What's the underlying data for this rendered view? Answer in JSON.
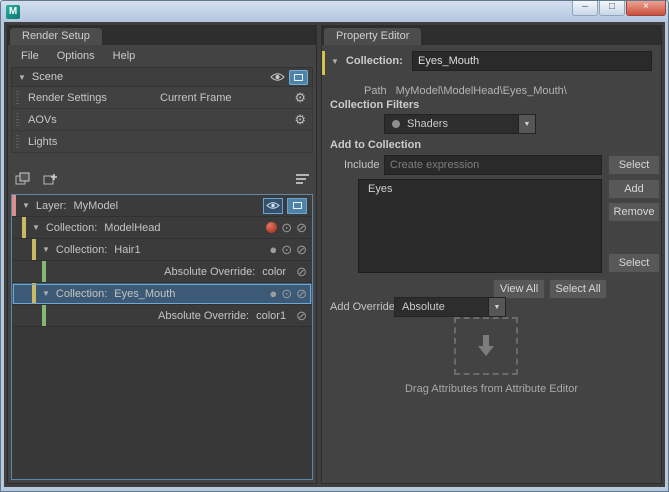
{
  "window": {
    "maya_icon": "M"
  },
  "icons": {
    "chevron_down": "▼",
    "gear": "⚙",
    "slash": "⊘",
    "target": "⊙",
    "dot": "●",
    "dropdown_arrow": "▼",
    "minimize": "–",
    "maximize": "□",
    "close": "×"
  },
  "left_panel": {
    "tab": "Render Setup",
    "menus": [
      "File",
      "Options",
      "Help"
    ],
    "scene": {
      "title": "Scene",
      "rows": [
        {
          "label": "Render Settings",
          "value": "Current Frame"
        },
        {
          "label": "AOVs"
        },
        {
          "label": "Lights"
        }
      ]
    },
    "tree": [
      {
        "label": "Layer:",
        "name": "MyModel"
      },
      {
        "label": "Collection:",
        "name": "ModelHead"
      },
      {
        "label": "Collection:",
        "name": "Hair1"
      },
      {
        "label": "Absolute Override:",
        "name": "color"
      },
      {
        "label": "Collection:",
        "name": "Eyes_Mouth"
      },
      {
        "label": "Absolute Override:",
        "name": "color1"
      }
    ]
  },
  "right_panel": {
    "tab": "Property Editor",
    "collection": {
      "label": "Collection:",
      "value": "Eyes_Mouth"
    },
    "path": {
      "label": "Path",
      "value": "MyModel\\ModelHead\\Eyes_Mouth\\"
    },
    "filters": {
      "label": "Collection Filters",
      "selected": "Shaders"
    },
    "add_to_collection": {
      "label": "Add to Collection",
      "include_label": "Include",
      "include_placeholder": "Create expression",
      "select_top": "Select",
      "items": [
        "Eyes"
      ],
      "add": "Add",
      "remove": "Remove",
      "select_bottom": "Select",
      "view_all": "View All",
      "select_all": "Select All"
    },
    "add_override": {
      "label": "Add Override",
      "selected": "Absolute"
    },
    "drop_hint": "Drag Attributes from Attribute Editor"
  },
  "colors": {
    "selection_blue": "#71a7d4",
    "layer_stripe": "#d9908c",
    "collection_stripe": "#c9ba62",
    "override_stripe": "#86b874",
    "accent_yellow": "#d6c050"
  }
}
